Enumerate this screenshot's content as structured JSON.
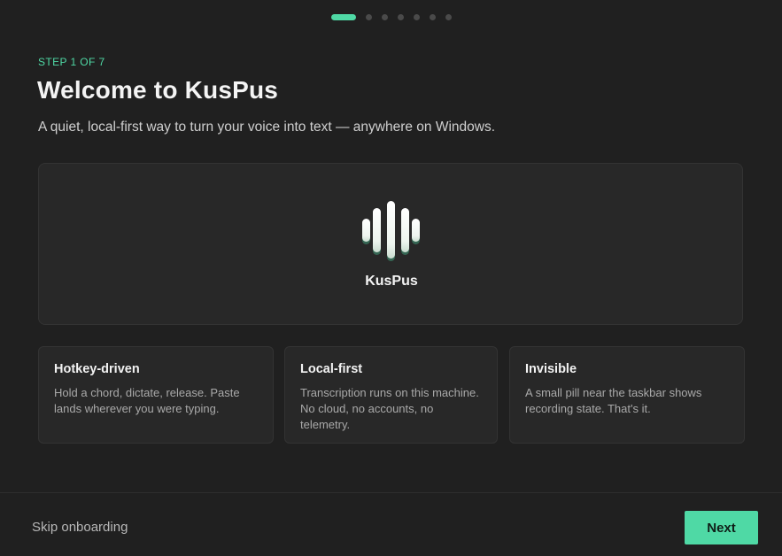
{
  "progress": {
    "total_steps": 7,
    "current_step": 1
  },
  "header": {
    "step_label": "STEP 1 OF 7",
    "title": "Welcome to KusPus",
    "subtitle": "A quiet, local-first way to turn your voice into text — anywhere on Windows."
  },
  "hero": {
    "icon": "soundwave-icon",
    "brand_name": "KusPus"
  },
  "features": [
    {
      "title": "Hotkey-driven",
      "body": "Hold a chord, dictate, release. Paste lands wherever you were typing."
    },
    {
      "title": "Local-first",
      "body": "Transcription runs on this machine. No cloud, no accounts, no telemetry."
    },
    {
      "title": "Invisible",
      "body": "A small pill near the taskbar shows recording state. That's it."
    }
  ],
  "footer": {
    "skip_label": "Skip onboarding",
    "next_label": "Next"
  },
  "colors": {
    "accent": "#4fd9a5",
    "background": "#202020",
    "card": "#282828"
  }
}
